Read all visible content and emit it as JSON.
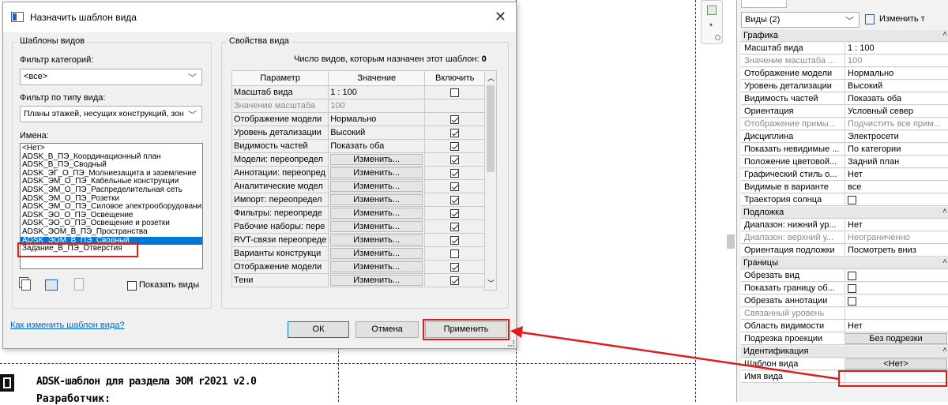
{
  "dialog": {
    "title": "Назначить шаблон вида",
    "close_glyph": "✕",
    "left_group": "Шаблоны видов",
    "category_filter_label": "Фильтр категорий:",
    "category_filter_value": "<все>",
    "type_filter_label": "Фильтр по типу вида:",
    "type_filter_value": "Планы этажей, несущих конструкций, зон",
    "names_label": "Имена:",
    "names": [
      "<Нет>",
      "ADSK_В_ПЭ_Координационный план",
      "ADSK_В_ПЭ_Сводный",
      "ADSK_ЭГ_О_ПЭ_Молниезащита и заземление",
      "ADSK_ЭМ_О_ПЭ_Кабельные конструкции",
      "ADSK_ЭМ_О_ПЭ_Распределительная сеть",
      "ADSK_ЭМ_О_ПЭ_Розетки",
      "ADSK_ЭМ_О_ПЭ_Силовое электрооборудовани",
      "ADSK_ЭО_О_ПЭ_Освещение",
      "ADSK_ЭО_О_ПЭ_Освещение и розетки",
      "ADSK_ЭОМ_В_ПЭ_Пространства",
      "ADSK_ЭОМ_В_ПЭ_Сводный",
      "Задание_В_ПЭ_Отверстия"
    ],
    "selected_index": 11,
    "show_views_label": "Показать виды",
    "right_group": "Свойства вида",
    "views_count_label": "Число видов, которым назначен этот шаблон:",
    "views_count_value": "0",
    "col_param": "Параметр",
    "col_value": "Значение",
    "col_include": "Включить",
    "rows": [
      {
        "p": "Масштаб вида",
        "v": "1 : 100",
        "btn": false,
        "on": false,
        "grey": false,
        "cb": true
      },
      {
        "p": "Значение масштаба",
        "v": "100",
        "btn": false,
        "on": false,
        "grey": true,
        "cb": false
      },
      {
        "p": "Отображение модели",
        "v": "Нормально",
        "btn": false,
        "on": true,
        "grey": false,
        "cb": true
      },
      {
        "p": "Уровень детализации",
        "v": "Высокий",
        "btn": false,
        "on": true,
        "grey": false,
        "cb": true
      },
      {
        "p": "Видимость частей",
        "v": "Показать оба",
        "btn": false,
        "on": true,
        "grey": false,
        "cb": true
      },
      {
        "p": "Модели: переопредел",
        "v": "Изменить...",
        "btn": true,
        "on": true,
        "grey": false,
        "cb": true
      },
      {
        "p": "Аннотации: переопред",
        "v": "Изменить...",
        "btn": true,
        "on": true,
        "grey": false,
        "cb": true
      },
      {
        "p": "Аналитические модел",
        "v": "Изменить...",
        "btn": true,
        "on": true,
        "grey": false,
        "cb": true
      },
      {
        "p": "Импорт: переопредел",
        "v": "Изменить...",
        "btn": true,
        "on": true,
        "grey": false,
        "cb": true
      },
      {
        "p": "Фильтры: переопреде",
        "v": "Изменить...",
        "btn": true,
        "on": true,
        "grey": false,
        "cb": true
      },
      {
        "p": "Рабочие наборы: пере",
        "v": "Изменить...",
        "btn": true,
        "on": true,
        "grey": false,
        "cb": true
      },
      {
        "p": "RVT-связи переопреде",
        "v": "Изменить...",
        "btn": true,
        "on": true,
        "grey": false,
        "cb": true
      },
      {
        "p": "Варианты конструкци",
        "v": "Изменить...",
        "btn": true,
        "on": false,
        "grey": false,
        "cb": true
      },
      {
        "p": "Отображение модели",
        "v": "Изменить...",
        "btn": true,
        "on": true,
        "grey": false,
        "cb": true
      },
      {
        "p": "Тени",
        "v": "Изменить...",
        "btn": true,
        "on": true,
        "grey": false,
        "cb": true
      }
    ],
    "help_link": "Как изменить шаблон вида?",
    "ok": "ОК",
    "cancel": "Отмена",
    "apply": "Применить"
  },
  "titleblock": {
    "line1": "ADSK-шаблон для раздела ЭОМ r2021 v2.0",
    "line2": "Разработчик:"
  },
  "panel": {
    "views_label": "Виды (2)",
    "edit_type": "Изменить т",
    "sections": [
      {
        "title": "Графика",
        "rows": [
          {
            "k": "Масштаб вида",
            "v": "1 : 100",
            "grey": false
          },
          {
            "k": "Значение масштаба ...",
            "v": "100",
            "grey": true
          },
          {
            "k": "Отображение модели",
            "v": "Нормально",
            "grey": false
          },
          {
            "k": "Уровень детализации",
            "v": "Высокий",
            "grey": false
          },
          {
            "k": "Видимость частей",
            "v": "Показать оба",
            "grey": false
          },
          {
            "k": "Ориентация",
            "v": "Условный север",
            "grey": false
          },
          {
            "k": "Отображение примы...",
            "v": "Подчистить все прим...",
            "grey": true
          },
          {
            "k": "Дисциплина",
            "v": "Электросети",
            "grey": false
          },
          {
            "k": "Показать невидимые ...",
            "v": "По категории",
            "grey": false
          },
          {
            "k": "Положение цветовой...",
            "v": "Задний план",
            "grey": false
          },
          {
            "k": "Графический стиль о...",
            "v": "Нет",
            "grey": false
          },
          {
            "k": "Видимые в варианте",
            "v": "все",
            "grey": false
          },
          {
            "k": "Траектория солнца",
            "v": "",
            "grey": false,
            "cb": true
          }
        ]
      },
      {
        "title": "Подложка",
        "rows": [
          {
            "k": "Диапазон: нижний ур...",
            "v": "Нет",
            "grey": false
          },
          {
            "k": "Диапазон: верхний у...",
            "v": "Неограниченно",
            "grey": true
          },
          {
            "k": "Ориентация подложки",
            "v": "Посмотреть вниз",
            "grey": false
          }
        ]
      },
      {
        "title": "Границы",
        "rows": [
          {
            "k": "Обрезать вид",
            "v": "",
            "grey": false,
            "cb": true
          },
          {
            "k": "Показать границу об...",
            "v": "",
            "grey": false,
            "cb": true
          },
          {
            "k": "Обрезать аннотации",
            "v": "",
            "grey": false,
            "cb": true
          },
          {
            "k": "Связанный уровень",
            "v": "",
            "grey": true
          },
          {
            "k": "Область видимости",
            "v": "Нет",
            "grey": false
          },
          {
            "k": "Подрезка проекции",
            "v": "Без подрезки",
            "grey": false,
            "btn": true
          }
        ]
      },
      {
        "title": "Идентификация",
        "rows": [
          {
            "k": "Шаблон вида",
            "v": "<Нет>",
            "grey": false,
            "btn": true
          },
          {
            "k": "Имя вида",
            "v": "",
            "grey": false
          }
        ]
      }
    ]
  }
}
